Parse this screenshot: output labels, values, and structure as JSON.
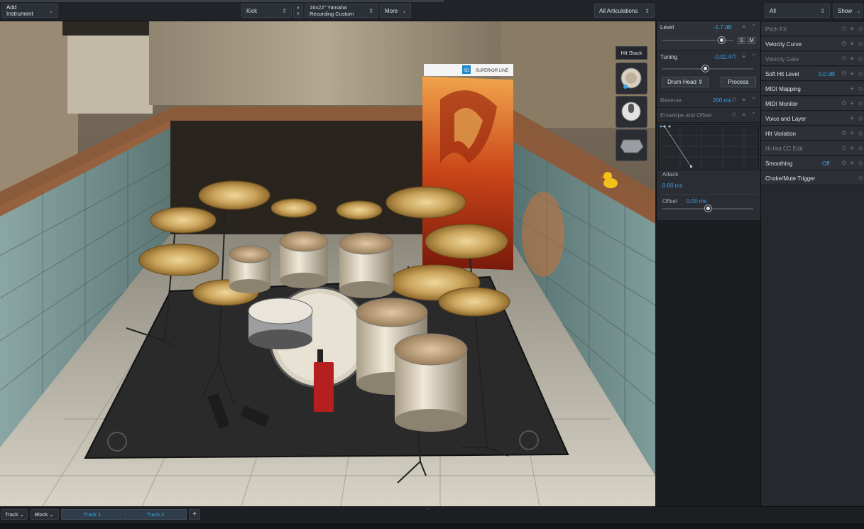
{
  "toolbar": {
    "add_instrument": "Add Instrument",
    "instrument": "Kick",
    "preset_line1": "16x22\" Yamaha",
    "preset_line2": "Recording Custom",
    "more": "More",
    "articulations": "All Articulations"
  },
  "stage": {
    "hit_stack_label": "Hit Stack",
    "banner_badge": "SD",
    "banner_title": "SUPERIOR LINE"
  },
  "inspector": {
    "level_label": "Level",
    "level_value": "-1.7 dB",
    "level_fraction": 0.83,
    "solo": "S",
    "mute": "M",
    "tuning_label": "Tuning",
    "tuning_value": "-0:02.4",
    "tuning_fraction": 0.47,
    "mode_select": "Drum Head",
    "process_button": "Process",
    "reverse_label": "Reverse",
    "reverse_value": "200 ms",
    "envelope_label": "Envelope and Offset",
    "attack_label": "Attack",
    "attack_value": "0.00 ms",
    "offset_label": "Offset",
    "offset_value": "0.00 ms",
    "offset_fraction": 0.5
  },
  "side": {
    "filter": "All",
    "show": "Show",
    "items": [
      {
        "name": "Pitch FX",
        "value": "",
        "enabled": false
      },
      {
        "name": "Velocity Curve",
        "value": "",
        "enabled": true
      },
      {
        "name": "Velocity Gate",
        "value": "",
        "enabled": false
      },
      {
        "name": "Soft Hit Level",
        "value": "0.0 dB",
        "enabled": true
      },
      {
        "name": "MIDI Mapping",
        "value": "",
        "enabled": true
      },
      {
        "name": "MIDI Monitor",
        "value": "",
        "enabled": true
      },
      {
        "name": "Voice and Layer",
        "value": "",
        "enabled": true
      },
      {
        "name": "Hit Variation",
        "value": "",
        "enabled": true
      },
      {
        "name": "Hi-Hat CC Edit",
        "value": "",
        "enabled": false
      },
      {
        "name": "Smoothing",
        "value": "Off",
        "enabled": true
      },
      {
        "name": "Choke/Mute Trigger",
        "value": "",
        "enabled": true
      }
    ]
  },
  "bottom": {
    "track_menu": "Track",
    "block_menu": "Block",
    "tab1": "Track 1",
    "tab2": "Track 2",
    "add": "+"
  }
}
